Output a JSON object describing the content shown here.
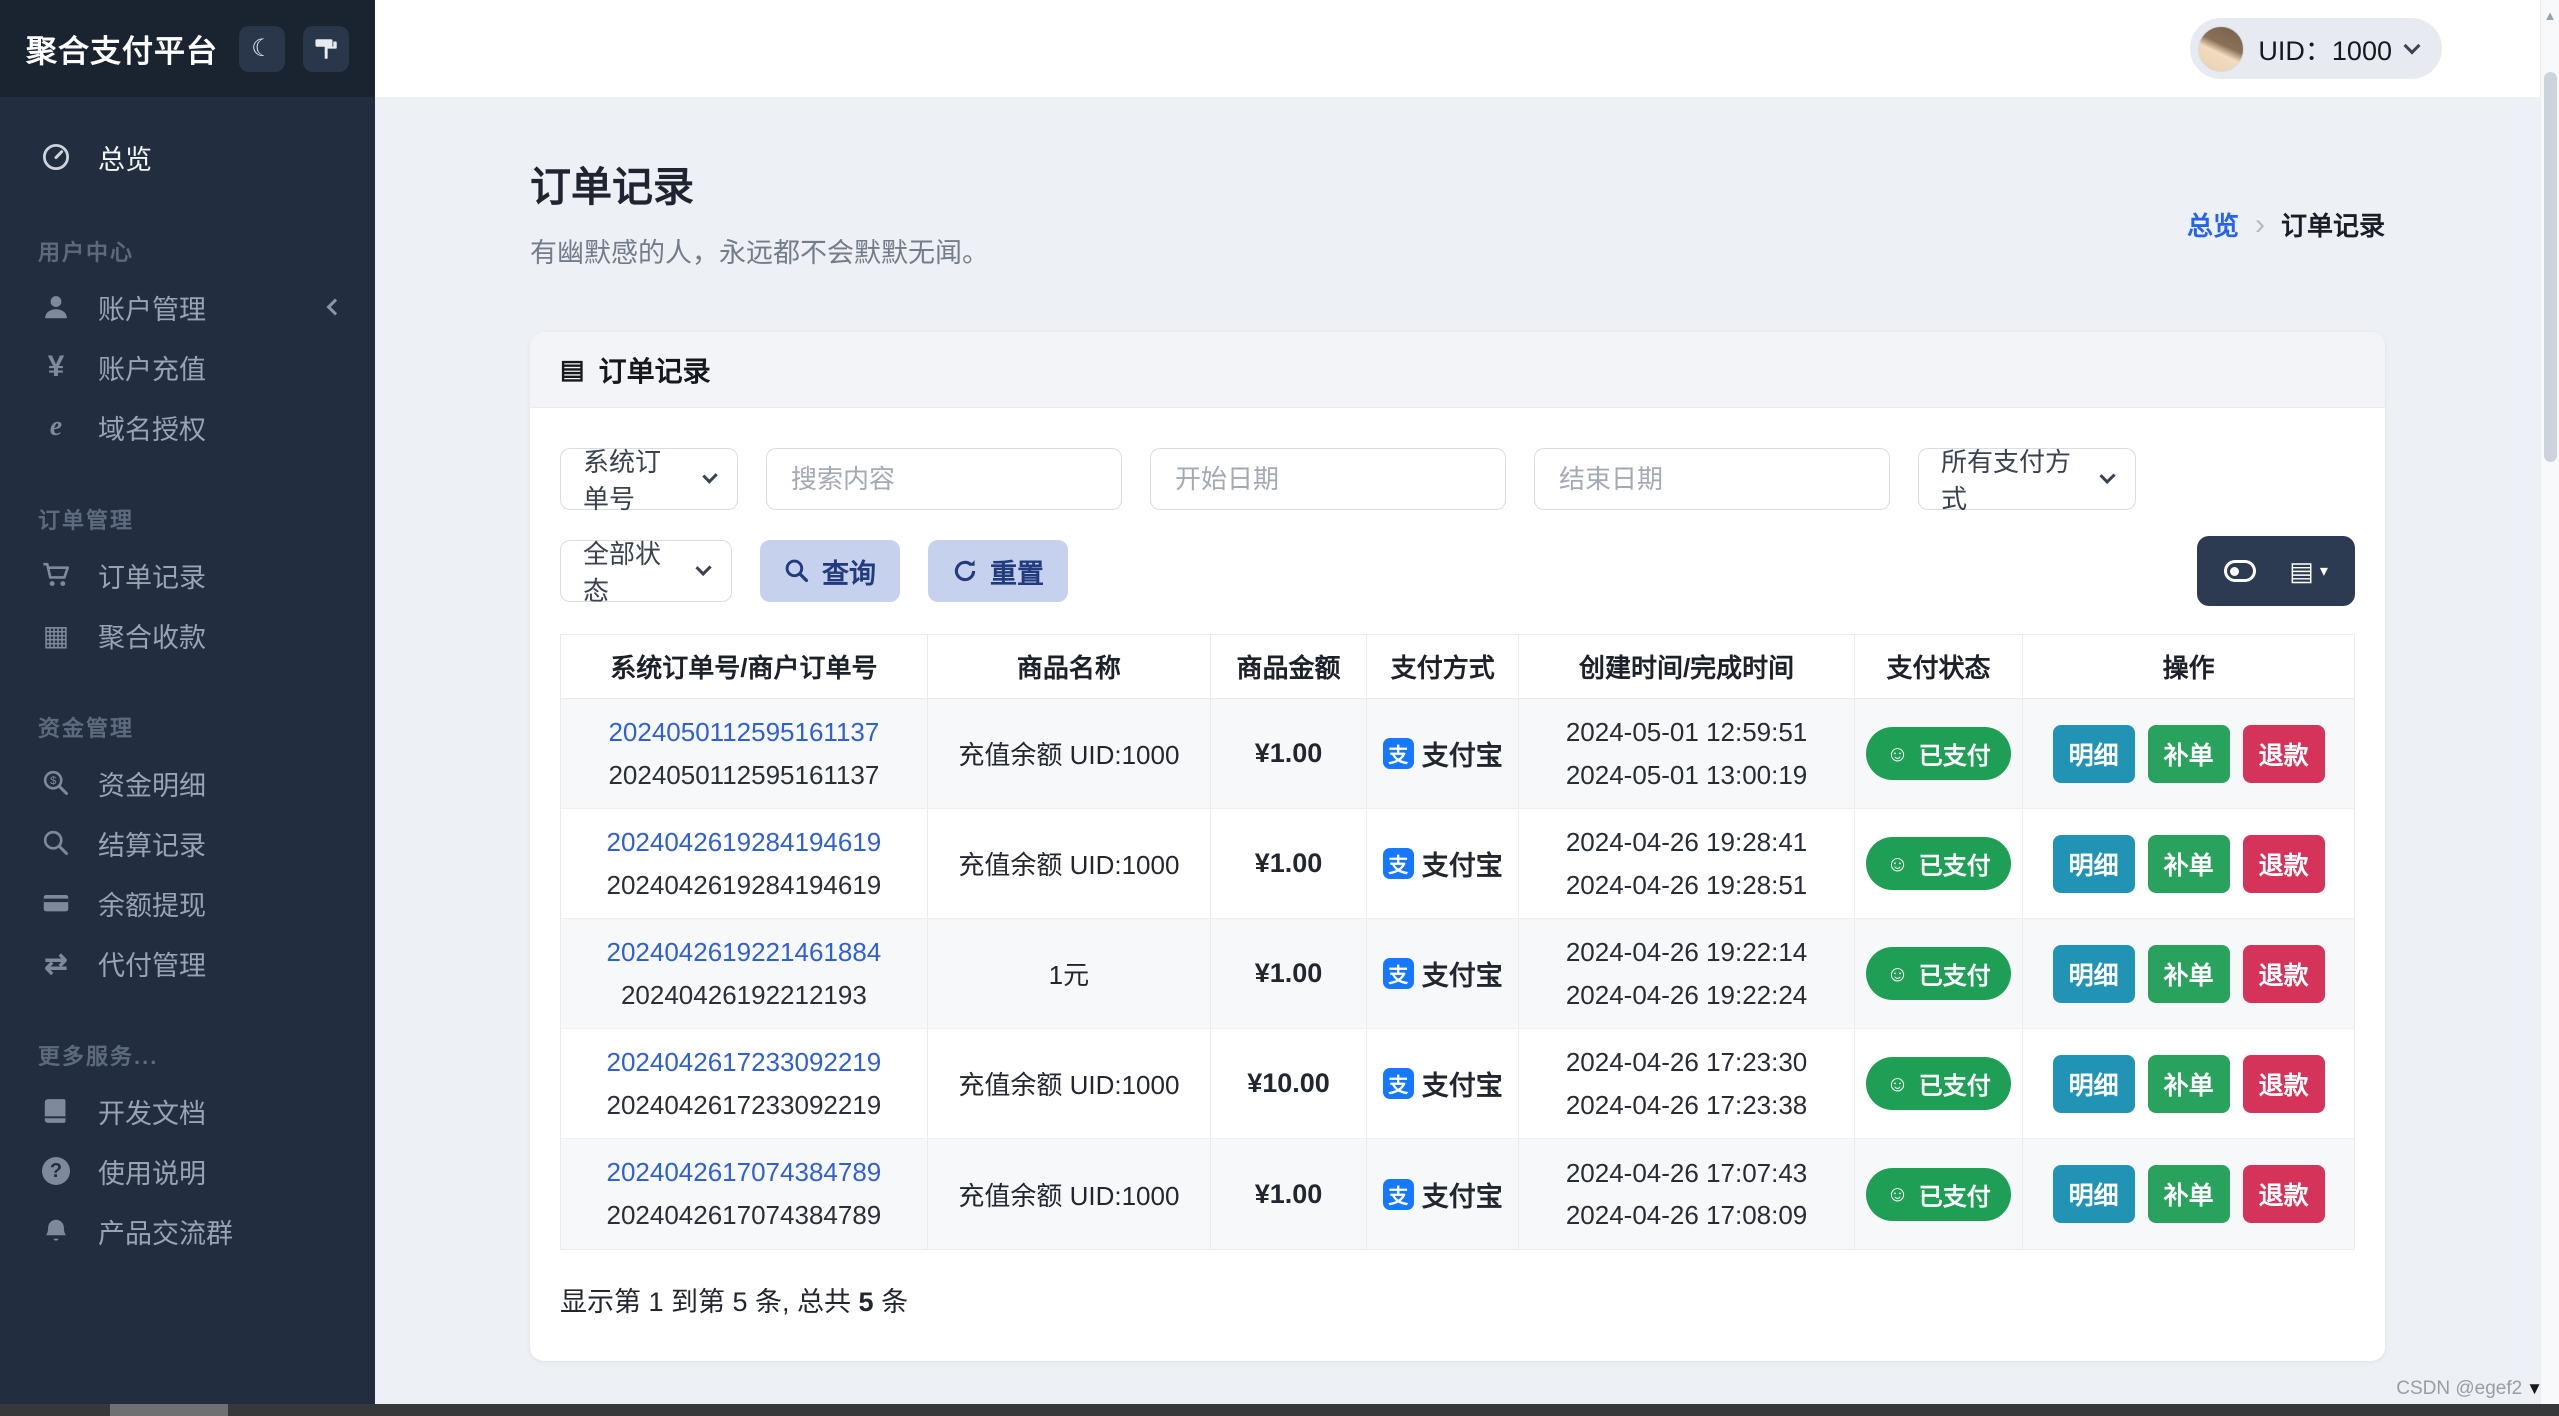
{
  "app_title": "聚合支付平台",
  "topbar": {
    "uid": "UID：1000"
  },
  "sidebar": {
    "overview": {
      "label": "总览"
    },
    "sections": [
      {
        "label": "用户中心",
        "items": [
          {
            "label": "账户管理"
          },
          {
            "label": "账户充值"
          },
          {
            "label": "域名授权"
          }
        ]
      },
      {
        "label": "订单管理",
        "items": [
          {
            "label": "订单记录"
          },
          {
            "label": "聚合收款"
          }
        ]
      },
      {
        "label": "资金管理",
        "items": [
          {
            "label": "资金明细"
          },
          {
            "label": "结算记录"
          },
          {
            "label": "余额提现"
          },
          {
            "label": "代付管理"
          }
        ]
      },
      {
        "label": "更多服务...",
        "items": [
          {
            "label": "开发文档"
          },
          {
            "label": "使用说明"
          },
          {
            "label": "产品交流群"
          }
        ]
      }
    ]
  },
  "page": {
    "title": "订单记录",
    "subtitle": "有幽默感的人，永远都不会默默无闻。",
    "breadcrumb": {
      "home": "总览",
      "current": "订单记录"
    }
  },
  "card": {
    "title": "订单记录"
  },
  "filters": {
    "order_type": "系统订单号",
    "search_placeholder": "搜索内容",
    "start_date_placeholder": "开始日期",
    "end_date_placeholder": "结束日期",
    "pay_method": "所有支付方式",
    "status": "全部状态",
    "query": "查询",
    "reset": "重置"
  },
  "table": {
    "headers": [
      "系统订单号/商户订单号",
      "商品名称",
      "商品金额",
      "支付方式",
      "创建时间/完成时间",
      "支付状态",
      "操作"
    ],
    "pay_alipay": "支付宝",
    "status_paid": "已支付",
    "actions": {
      "detail": "明细",
      "reorder": "补单",
      "refund": "退款"
    },
    "rows": [
      {
        "sys_no": "2024050112595161137",
        "merchant_no": "2024050112595161137",
        "product": "充值余额 UID:1000",
        "amount": "¥1.00",
        "created": "2024-05-01 12:59:51",
        "completed": "2024-05-01 13:00:19"
      },
      {
        "sys_no": "2024042619284194619",
        "merchant_no": "2024042619284194619",
        "product": "充值余额 UID:1000",
        "amount": "¥1.00",
        "created": "2024-04-26 19:28:41",
        "completed": "2024-04-26 19:28:51"
      },
      {
        "sys_no": "2024042619221461884",
        "merchant_no": "20240426192212193",
        "product": "1元",
        "amount": "¥1.00",
        "created": "2024-04-26 19:22:14",
        "completed": "2024-04-26 19:22:24"
      },
      {
        "sys_no": "2024042617233092219",
        "merchant_no": "2024042617233092219",
        "product": "充值余额 UID:1000",
        "amount": "¥10.00",
        "created": "2024-04-26 17:23:30",
        "completed": "2024-04-26 17:23:38"
      },
      {
        "sys_no": "2024042617074384789",
        "merchant_no": "2024042617074384789",
        "product": "充值余额 UID:1000",
        "amount": "¥1.00",
        "created": "2024-04-26 17:07:43",
        "completed": "2024-04-26 17:08:09"
      }
    ],
    "footer": {
      "prefix": "显示第 1 到第 5 条, 总共 ",
      "total": "5",
      "suffix": " 条"
    }
  },
  "watermark": "CSDN @egef2",
  "icons": {
    "moon": "☾",
    "yen": "¥",
    "globe": "e",
    "qr": "▦",
    "transfer": "⇄",
    "question": "?",
    "table": "▤",
    "list": "▤",
    "caret": "▾",
    "smiley": "☺",
    "alipay": "支",
    "breadcrumb_sep": "›",
    "scroll_up": "▲",
    "watermark_tri": "▼"
  },
  "colors": {
    "accent_blue": "#2563eb",
    "link_blue": "#2f5fd6",
    "paid_green": "#1f9e55",
    "btn_detail": "#2193b5",
    "btn_reorder": "#28a25c",
    "btn_refund": "#d5335a",
    "alipay_blue": "#1677ff",
    "sidebar_bg": "#222d40",
    "soft_btn_bg": "#c6d1ee"
  }
}
